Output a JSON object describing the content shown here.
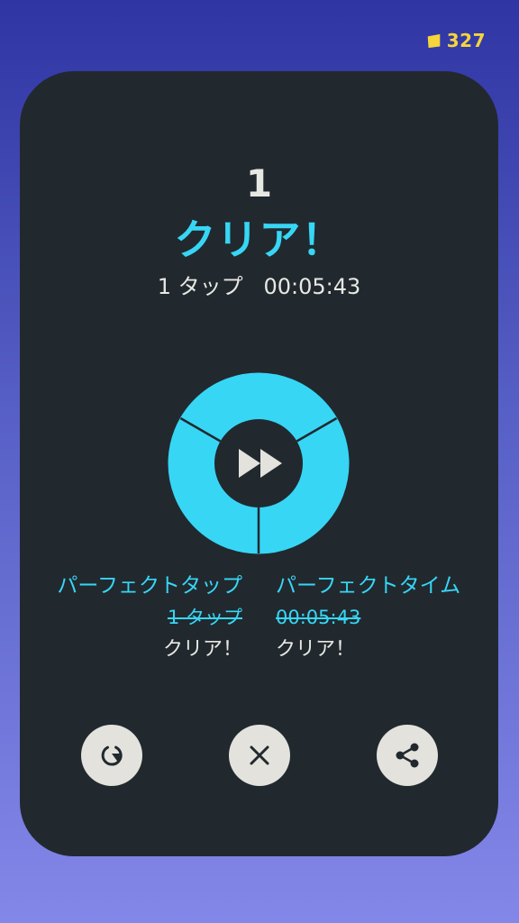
{
  "coins": {
    "count": "327",
    "icon": "coin-icon",
    "color": "#f5d43c"
  },
  "result": {
    "level": "1",
    "title": "クリア！",
    "summary": "1 タップ   00:05:43"
  },
  "ring": {
    "icon": "fast-forward-icon",
    "color": "#37d6f5"
  },
  "perfect": {
    "tap": {
      "heading": "パーフェクトタップ",
      "value": "1 タップ",
      "status": "クリア！"
    },
    "time": {
      "heading": "パーフェクトタイム",
      "value": "00:05:43",
      "status": "クリア！"
    }
  },
  "actions": [
    {
      "name": "retry",
      "icon": "retry-icon"
    },
    {
      "name": "close",
      "icon": "close-icon"
    },
    {
      "name": "share",
      "icon": "share-icon"
    }
  ],
  "colors": {
    "accent": "#37d6f5",
    "card": "#21292f",
    "text": "#e8e8e3",
    "button": "#e3e2dd",
    "coin": "#f5d43c"
  }
}
